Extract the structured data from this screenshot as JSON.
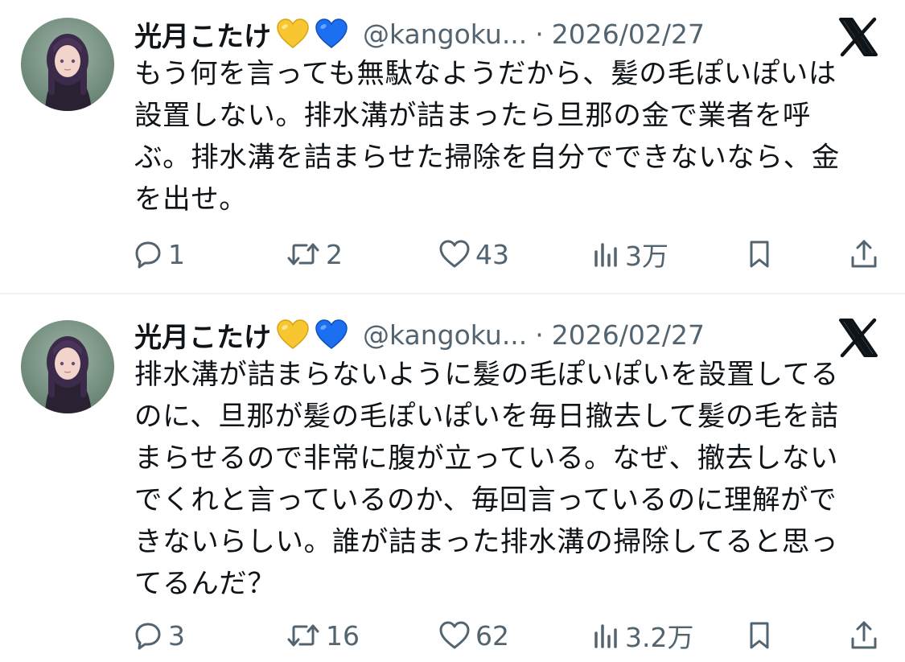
{
  "colors": {
    "text": "#0f1419",
    "secondary": "#536471",
    "divider": "#eff3f4",
    "yellow_heart": "#f7c631",
    "blue_heart": "#1d6ff2"
  },
  "icons": {
    "badge_1": "yellow-heart-icon",
    "badge_2": "blue-heart-icon",
    "platform": "x-logo-icon",
    "reply": "reply-icon",
    "retweet": "retweet-icon",
    "like": "like-icon",
    "views": "views-icon",
    "bookmark": "bookmark-icon",
    "share": "share-icon"
  },
  "tweets": [
    {
      "display_name": "光月こたけ",
      "handle": "@kangoku...",
      "separator": "·",
      "date": "2026/02/27",
      "text": "もう何を言っても無駄なようだから、髪の毛ぽいぽいは\n設置しない。排水溝が詰まったら旦那の金で業者を呼\nぶ。排水溝を詰まらせた掃除を自分でできないなら、金\nを出せ。",
      "replies": "1",
      "retweets": "2",
      "likes": "43",
      "views": "3万"
    },
    {
      "display_name": "光月こたけ",
      "handle": "@kangoku...",
      "separator": "·",
      "date": "2026/02/27",
      "text": "排水溝が詰まらないように髪の毛ぽいぽいを設置してる\nのに、旦那が髪の毛ぽいぽいを毎日撤去して髪の毛を詰\nまらせるので非常に腹が立っている。なぜ、撤去しない\nでくれと言っているのか、毎回言っているのに理解がで\nきないらしい。誰が詰まった排水溝の掃除してると思っ\nてるんだ？",
      "replies": "3",
      "retweets": "16",
      "likes": "62",
      "views": "3.2万"
    }
  ]
}
